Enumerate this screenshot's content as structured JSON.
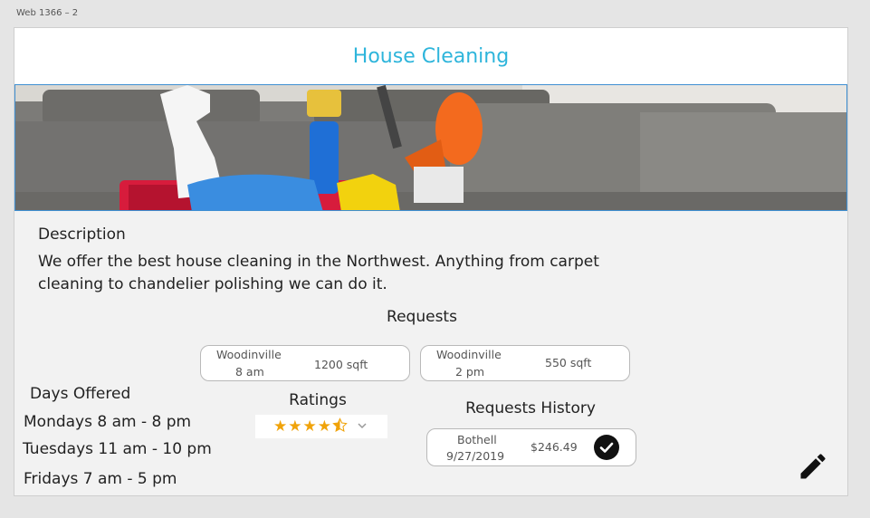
{
  "artboard": {
    "label": "Web 1366 – 2"
  },
  "header": {
    "title": "House Cleaning"
  },
  "description": {
    "heading": "Description",
    "text": "We offer the best house cleaning in the Northwest. Anything from carpet cleaning to chandelier polishing we can do it."
  },
  "requests": {
    "heading": "Requests",
    "items": [
      {
        "city": "Woodinville",
        "time": "8 am",
        "size": "1200 sqft"
      },
      {
        "city": "Woodinville",
        "time": "2 pm",
        "size": "550 sqft"
      }
    ]
  },
  "days": {
    "heading": "Days Offered",
    "items": [
      "Mondays 8 am - 8 pm",
      "Tuesdays 11 am - 10 pm",
      "Fridays 7 am - 5 pm"
    ]
  },
  "ratings": {
    "heading": "Ratings",
    "value": 4.5,
    "max": 5
  },
  "history": {
    "heading": "Requests History",
    "items": [
      {
        "city": "Bothell",
        "date": "9/27/2019",
        "amount": "$246.49",
        "status": "completed"
      }
    ]
  },
  "icons": {
    "edit": "pencil-icon",
    "check": "checkmark-circle-icon",
    "dropdown": "chevron-down-icon"
  },
  "colors": {
    "title": "#2eb5db",
    "star": "#f0a30a",
    "hero_border": "#3f8fd2"
  }
}
